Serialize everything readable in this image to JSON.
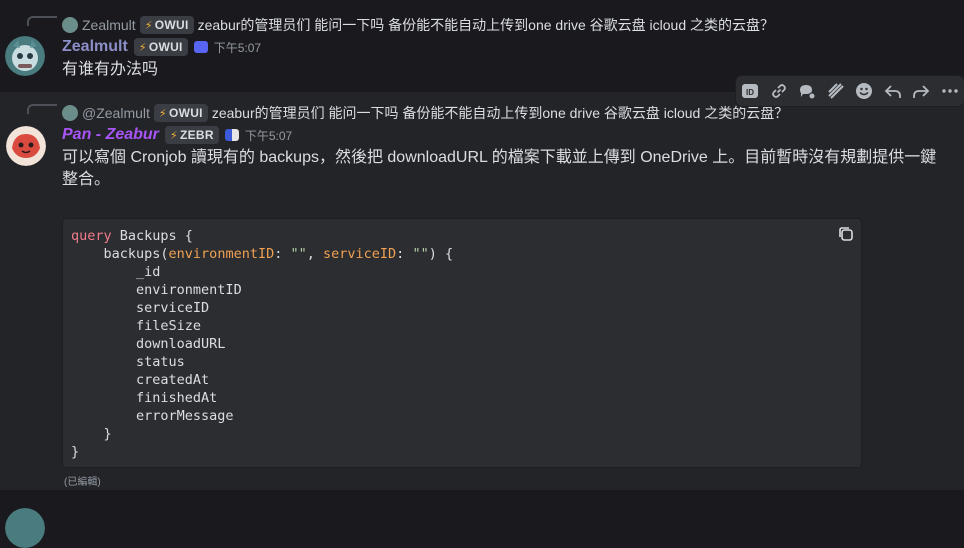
{
  "message1": {
    "reply": {
      "author": "Zealmult",
      "badge": "OWUI",
      "text": "zeabur的管理员们 能问一下吗 备份能不能自动上传到one drive 谷歌云盘 icloud 之类的云盘？"
    },
    "author": "Zealmult",
    "badge": "OWUI",
    "timestamp": "下午5:07",
    "text": "有谁有办法吗"
  },
  "message2": {
    "reply": {
      "author": "@Zealmult",
      "badge": "OWUI",
      "text": "zeabur的管理员们 能问一下吗 备份能不能自动上传到one drive 谷歌云盘 icloud 之类的云盘？"
    },
    "author": "Pan - Zeabur",
    "badge": "ZEBR",
    "timestamp": "下午5:07",
    "text": "可以寫個 Cronjob 讀現有的 backups，然後把 downloadURL 的檔案下載並上傳到 OneDrive 上。目前暫時沒有規劃提供一鍵整合。",
    "code": {
      "l1_kw": "query",
      "l1_rest": " Backups {",
      "l2_a": "    backups(",
      "l2_attr1": "environmentID",
      "l2_b": ": ",
      "l2_str1": "\"\"",
      "l2_c": ", ",
      "l2_attr2": "serviceID",
      "l2_d": ": ",
      "l2_str2": "\"\"",
      "l2_e": ") {",
      "fields": [
        "_id",
        "environmentID",
        "serviceID",
        "fileSize",
        "downloadURL",
        "status",
        "createdAt",
        "finishedAt",
        "errorMessage"
      ],
      "close_inner": "    }",
      "close_outer": "}"
    },
    "edited": "(已編輯)"
  },
  "colors": {
    "zealmult": "#8b8fc7",
    "pan": "#a855f7",
    "role_purple": "#5865f2"
  },
  "toolbar_icons": [
    "id-icon",
    "link-icon",
    "thread-icon",
    "pin-stripe-icon",
    "emoji-icon",
    "reply-icon",
    "forward-icon",
    "more-icon"
  ]
}
